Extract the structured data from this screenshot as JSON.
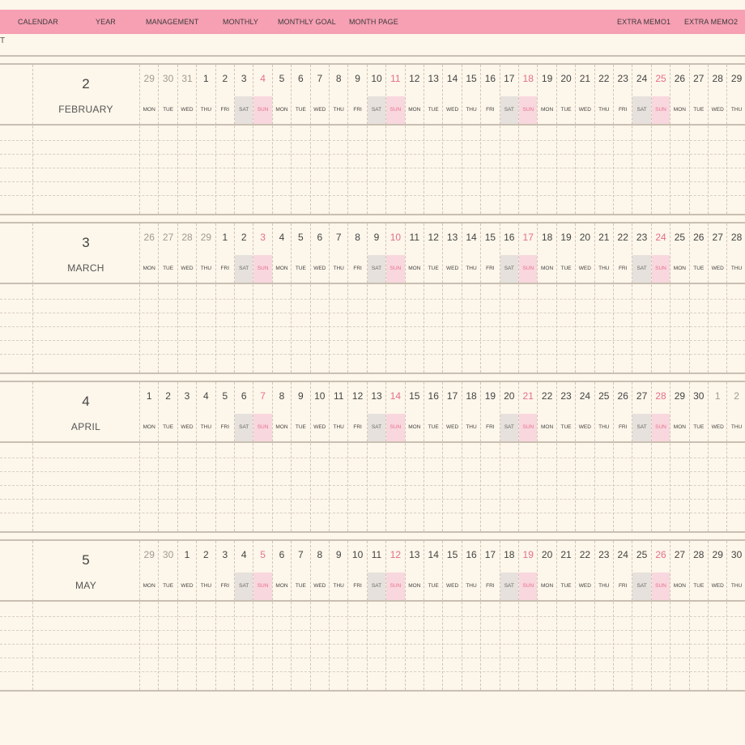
{
  "nav": {
    "calendar": "CALENDAR",
    "year": "YEAR",
    "management": "MANAGEMENT",
    "monthly": "MONTHLY",
    "monthly_goal": "MONTHLY GOAL",
    "month_page": "MONTH PAGE",
    "extra_memo1": "EXTRA MEMO1",
    "extra_memo2": "EXTRA MEMO2"
  },
  "stray_char": "T",
  "colors": {
    "nav_bg": "#f79fb3",
    "page_bg": "#fdf6ea",
    "sunday": "#e46f8b",
    "saturday_bg": "#e6e1dc",
    "sunday_bg": "#f9d7de"
  },
  "months": [
    {
      "number": "2",
      "name": "FEBRUARY",
      "dates": [
        "29",
        "30",
        "31",
        "1",
        "2",
        "3",
        "4",
        "5",
        "6",
        "7",
        "8",
        "9",
        "10",
        "11",
        "12",
        "13",
        "14",
        "15",
        "16",
        "17",
        "18",
        "19",
        "20",
        "21",
        "22",
        "23",
        "24",
        "25",
        "26",
        "27",
        "28",
        "29"
      ],
      "adjacent": [
        0,
        1,
        2
      ],
      "days": [
        "MON",
        "TUE",
        "WED",
        "THU",
        "FRI",
        "SAT",
        "SUN",
        "MON",
        "TUE",
        "WED",
        "THU",
        "FRI",
        "SAT",
        "SUN",
        "MON",
        "TUE",
        "WED",
        "THU",
        "FRI",
        "SAT",
        "SUN",
        "MON",
        "TUE",
        "WED",
        "THU",
        "FRI",
        "SAT",
        "SUN",
        "MON",
        "TUE",
        "WED",
        "THU"
      ]
    },
    {
      "number": "3",
      "name": "MARCH",
      "dates": [
        "26",
        "27",
        "28",
        "29",
        "1",
        "2",
        "3",
        "4",
        "5",
        "6",
        "7",
        "8",
        "9",
        "10",
        "11",
        "12",
        "13",
        "14",
        "15",
        "16",
        "17",
        "18",
        "19",
        "20",
        "21",
        "22",
        "23",
        "24",
        "25",
        "26",
        "27",
        "28"
      ],
      "adjacent": [
        0,
        1,
        2,
        3
      ],
      "days": [
        "MON",
        "TUE",
        "WED",
        "THU",
        "FRI",
        "SAT",
        "SUN",
        "MON",
        "TUE",
        "WED",
        "THU",
        "FRI",
        "SAT",
        "SUN",
        "MON",
        "TUE",
        "WED",
        "THU",
        "FRI",
        "SAT",
        "SUN",
        "MON",
        "TUE",
        "WED",
        "THU",
        "FRI",
        "SAT",
        "SUN",
        "MON",
        "TUE",
        "WED",
        "THU"
      ]
    },
    {
      "number": "4",
      "name": "APRIL",
      "dates": [
        "1",
        "2",
        "3",
        "4",
        "5",
        "6",
        "7",
        "8",
        "9",
        "10",
        "11",
        "12",
        "13",
        "14",
        "15",
        "16",
        "17",
        "18",
        "19",
        "20",
        "21",
        "22",
        "23",
        "24",
        "25",
        "26",
        "27",
        "28",
        "29",
        "30",
        "1",
        "2"
      ],
      "adjacent": [
        30,
        31
      ],
      "days": [
        "MON",
        "TUE",
        "WED",
        "THU",
        "FRI",
        "SAT",
        "SUN",
        "MON",
        "TUE",
        "WED",
        "THU",
        "FRI",
        "SAT",
        "SUN",
        "MON",
        "TUE",
        "WED",
        "THU",
        "FRI",
        "SAT",
        "SUN",
        "MON",
        "TUE",
        "WED",
        "THU",
        "FRI",
        "SAT",
        "SUN",
        "MON",
        "TUE",
        "WED",
        "THU"
      ]
    },
    {
      "number": "5",
      "name": "MAY",
      "dates": [
        "29",
        "30",
        "1",
        "2",
        "3",
        "4",
        "5",
        "6",
        "7",
        "8",
        "9",
        "10",
        "11",
        "12",
        "13",
        "14",
        "15",
        "16",
        "17",
        "18",
        "19",
        "20",
        "21",
        "22",
        "23",
        "24",
        "25",
        "26",
        "27",
        "28",
        "29",
        "30"
      ],
      "adjacent": [
        0,
        1
      ],
      "days": [
        "MON",
        "TUE",
        "WED",
        "THU",
        "FRI",
        "SAT",
        "SUN",
        "MON",
        "TUE",
        "WED",
        "THU",
        "FRI",
        "SAT",
        "SUN",
        "MON",
        "TUE",
        "WED",
        "THU",
        "FRI",
        "SAT",
        "SUN",
        "MON",
        "TUE",
        "WED",
        "THU",
        "FRI",
        "SAT",
        "SUN",
        "MON",
        "TUE",
        "WED",
        "THU"
      ]
    }
  ]
}
